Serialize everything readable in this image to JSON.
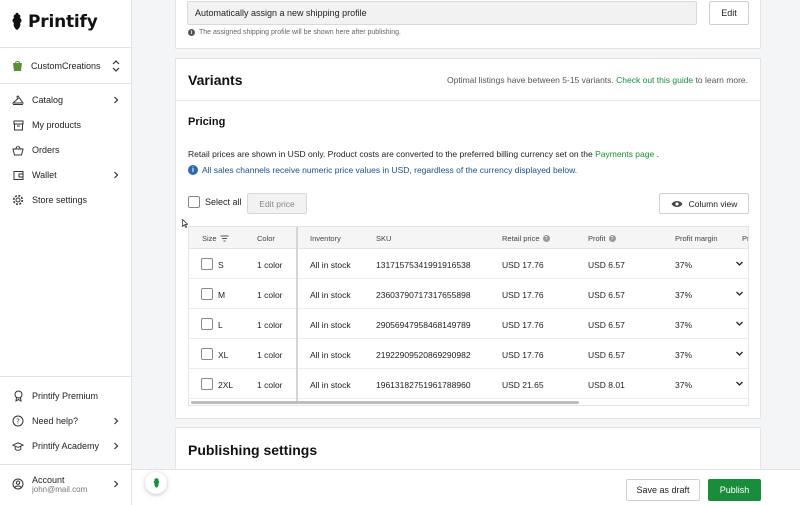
{
  "brand": {
    "name": "Printify",
    "accent": "#1a8d3c"
  },
  "sidebar": {
    "store_name": "CustomCreations",
    "items": [
      {
        "label": "Catalog",
        "icon": "hanger-icon",
        "has_chevron": true
      },
      {
        "label": "My products",
        "icon": "archive-box-icon",
        "has_chevron": false
      },
      {
        "label": "Orders",
        "icon": "basket-icon",
        "has_chevron": false
      },
      {
        "label": "Wallet",
        "icon": "wallet-icon",
        "has_chevron": true
      },
      {
        "label": "Store settings",
        "icon": "gear-icon",
        "has_chevron": false
      }
    ],
    "bottom_items": [
      {
        "label": "Printify Premium",
        "icon": "premium-badge-icon"
      },
      {
        "label": "Need help?",
        "icon": "help-circle-icon"
      },
      {
        "label": "Printify Academy",
        "icon": "graduation-cap-icon"
      }
    ],
    "account": {
      "label": "Account",
      "email": "john@mail.com"
    }
  },
  "shipping": {
    "value": "Automatically assign a new shipping profile",
    "edit_label": "Edit",
    "hint": "The assigned shipping profile will be shown here after publishing."
  },
  "variants": {
    "title": "Variants",
    "note_prefix": "Optimal listings have between 5-15 variants.",
    "note_link": "Check out this guide",
    "note_suffix": "to learn more.",
    "pricing_title": "Pricing",
    "retail_note": "Retail prices are shown in USD only. Product costs are converted to the preferred billing currency set on the",
    "retail_link": "Payments page",
    "retail_end": ".",
    "info_text": "All sales channels receive numeric price values in USD, regardless of the currency displayed below.",
    "select_all": "Select all",
    "edit_price": "Edit price",
    "column_view": "Column view"
  },
  "table": {
    "headers": [
      "Size",
      "Color",
      "Inventory",
      "SKU",
      "Retail price",
      "Profit",
      "Profit margin",
      "Pr"
    ],
    "rows": [
      [
        "S",
        "1 color",
        "All in stock",
        "13171575341991916538",
        "USD 17.76",
        "USD 6.57",
        "37%"
      ],
      [
        "M",
        "1 color",
        "All in stock",
        "23603790717317655898",
        "USD 17.76",
        "USD 6.57",
        "37%"
      ],
      [
        "L",
        "1 color",
        "All in stock",
        "29056947958468149789",
        "USD 17.76",
        "USD 6.57",
        "37%"
      ],
      [
        "XL",
        "1 color",
        "All in stock",
        "21922909520869290982",
        "USD 17.76",
        "USD 6.57",
        "37%"
      ],
      [
        "2XL",
        "1 color",
        "All in stock",
        "19613182751961788960",
        "USD 21.65",
        "USD 8.01",
        "37%"
      ]
    ]
  },
  "publishing": {
    "title": "Publishing settings"
  },
  "actions": {
    "save_draft": "Save as draft",
    "publish": "Publish"
  }
}
